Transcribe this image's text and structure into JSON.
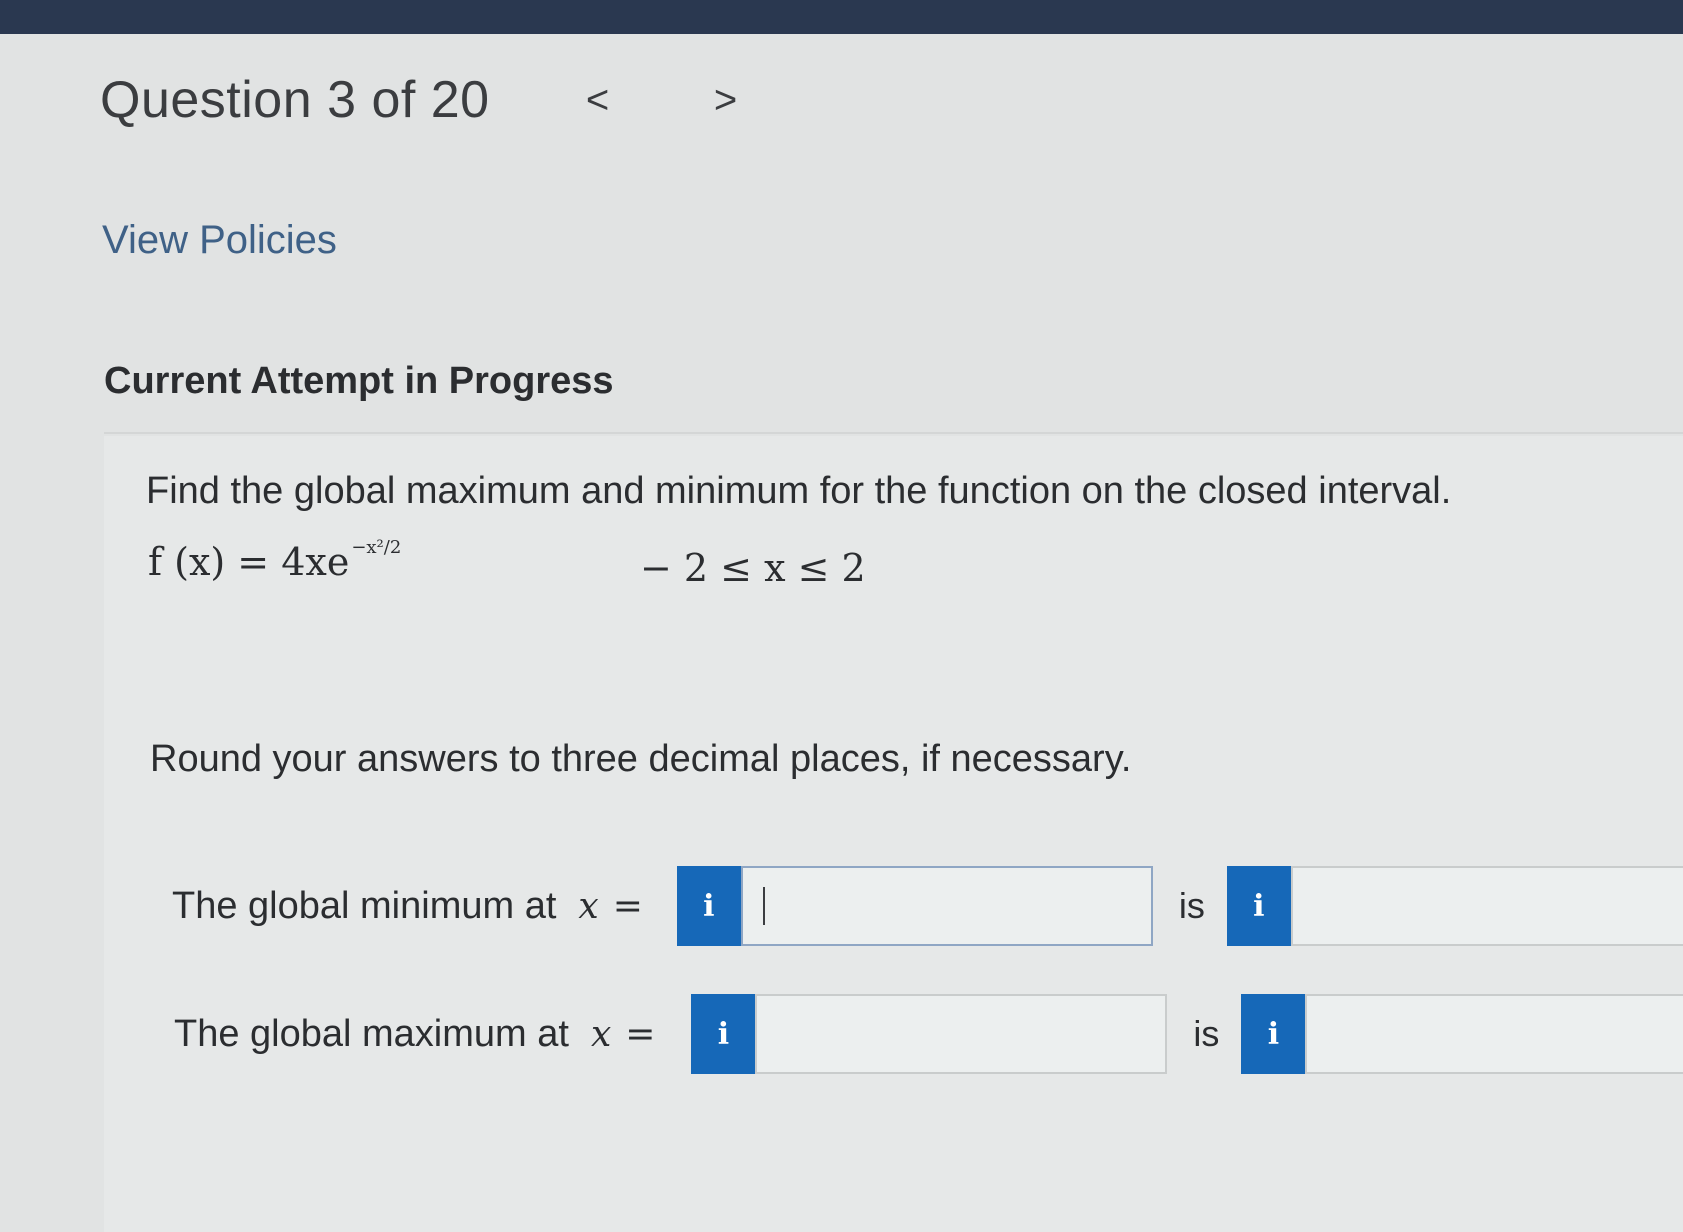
{
  "header": {
    "question_title": "Question 3 of 20",
    "prev_symbol": "<",
    "next_symbol": ">"
  },
  "links": {
    "view_policies": "View Policies"
  },
  "attempt": {
    "heading": "Current Attempt in Progress"
  },
  "problem": {
    "prompt": "Find the global maximum and minimum for the function on the closed interval.",
    "function_text": "f (x) = 4xe",
    "exponent_text": "−x²/2",
    "interval_text": "− 2 ≤ x ≤ 2",
    "round_note": "Round your answers to three decimal places, if necessary."
  },
  "answers": {
    "min_label": "The global minimum at",
    "max_label": "The global maximum at",
    "var_symbol": "x",
    "eq_symbol": "=",
    "is_label": "is",
    "info_symbol": "i",
    "min_x_value": "",
    "min_value": "",
    "max_x_value": "",
    "max_value": ""
  },
  "colors": {
    "top_bar": "#2a3850",
    "info_button": "#1668b8",
    "link": "#3f6187"
  }
}
